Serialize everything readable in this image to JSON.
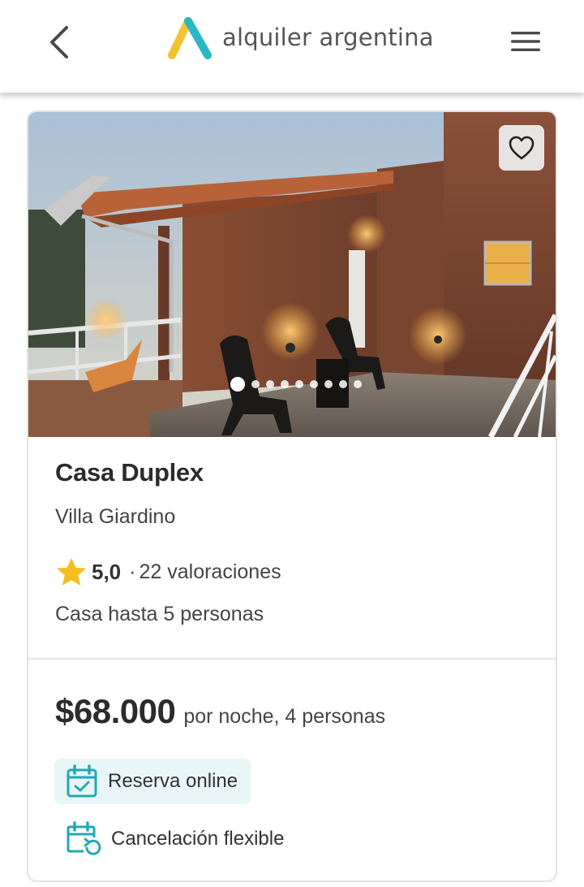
{
  "header": {
    "brand_name": "alquiler argentina",
    "back_icon": "chevron-left-icon",
    "menu_icon": "hamburger-menu-icon"
  },
  "listing": {
    "title": "Casa Duplex",
    "location": "Villa Giardino",
    "rating": {
      "value": "5,0",
      "separator": "·",
      "count_label": "22 valoraciones"
    },
    "capacity": "Casa hasta 5 personas",
    "photo_carousel": {
      "total_images": 9,
      "current_index": 1
    },
    "price": {
      "amount": "$68.000",
      "note": "por noche, 4 personas"
    },
    "features": {
      "online_booking": "Reserva online",
      "flexible_cancellation": "Cancelación flexible"
    }
  },
  "colors": {
    "brand_teal": "#2bb8c4",
    "brand_yellow": "#f2c230",
    "star": "#f5bd1f",
    "badge_bg": "#e8f6f7"
  }
}
